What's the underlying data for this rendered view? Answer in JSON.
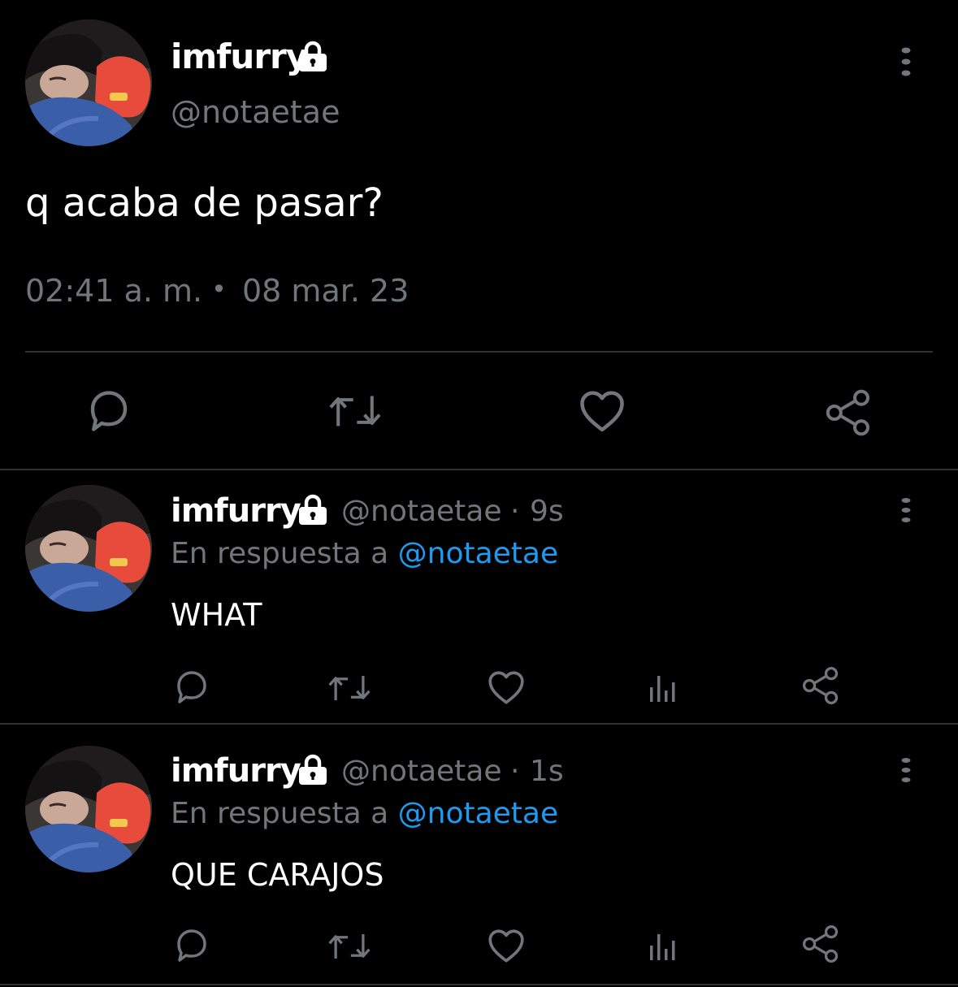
{
  "main_tweet": {
    "display_name": "imfurry",
    "handle": "@notaetae",
    "text": "q acaba de pasar?",
    "time": "02:41 a. m.",
    "separator": "•",
    "date": "08 mar. 23",
    "protected_icon": "lock-icon",
    "more_icon": "more-vertical-icon",
    "actions": [
      "reply-icon",
      "retweet-icon",
      "like-icon",
      "share-icon"
    ]
  },
  "replies": [
    {
      "display_name": "imfurry",
      "handle": "@notaetae",
      "dot": "·",
      "age": "9s",
      "reply_prefix": "En respuesta a",
      "reply_to": "@notaetae",
      "text": "WHAT"
    },
    {
      "display_name": "imfurry",
      "handle": "@notaetae",
      "dot": "·",
      "age": "1s",
      "reply_prefix": "En respuesta a",
      "reply_to": "@notaetae",
      "text": "QUE CARAJOS"
    }
  ],
  "reply_actions": [
    "reply-icon",
    "retweet-icon",
    "like-icon",
    "analytics-icon",
    "share-icon"
  ],
  "colors": {
    "background": "#000000",
    "text": "#ffffff",
    "secondary": "#71767b",
    "link": "#1d9bf0",
    "divider": "#2f3336"
  }
}
